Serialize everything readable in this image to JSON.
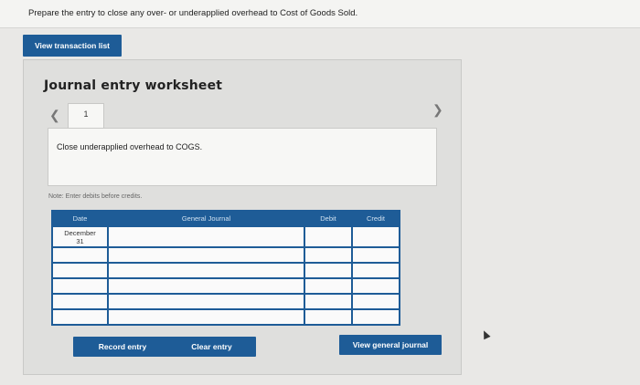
{
  "instruction": "Prepare the entry to close any over- or underapplied overhead to Cost of Goods Sold.",
  "buttons": {
    "view_transaction_list": "View transaction list",
    "record_entry": "Record entry",
    "clear_entry": "Clear entry",
    "view_general_journal": "View general journal"
  },
  "worksheet": {
    "title": "Journal entry worksheet",
    "tab_number": "1",
    "description": "Close underapplied overhead to COGS.",
    "note": "Note: Enter debits before credits."
  },
  "table": {
    "headers": {
      "date": "Date",
      "general_journal": "General Journal",
      "debit": "Debit",
      "credit": "Credit"
    },
    "rows": [
      {
        "date_line1": "December",
        "date_line2": "31",
        "account": "",
        "debit": "",
        "credit": ""
      },
      {
        "date_line1": "",
        "date_line2": "",
        "account": "",
        "debit": "",
        "credit": ""
      },
      {
        "date_line1": "",
        "date_line2": "",
        "account": "",
        "debit": "",
        "credit": ""
      },
      {
        "date_line1": "",
        "date_line2": "",
        "account": "",
        "debit": "",
        "credit": ""
      },
      {
        "date_line1": "",
        "date_line2": "",
        "account": "",
        "debit": "",
        "credit": ""
      },
      {
        "date_line1": "",
        "date_line2": "",
        "account": "",
        "debit": "",
        "credit": ""
      }
    ]
  },
  "icons": {
    "prev": "chevron-left-icon",
    "next": "chevron-right-icon",
    "cursor": "mouse-cursor-icon"
  },
  "colors": {
    "primary_button": "#1e5c97",
    "header_bg": "#1e5c97",
    "panel_bg": "#dfdfdd"
  }
}
